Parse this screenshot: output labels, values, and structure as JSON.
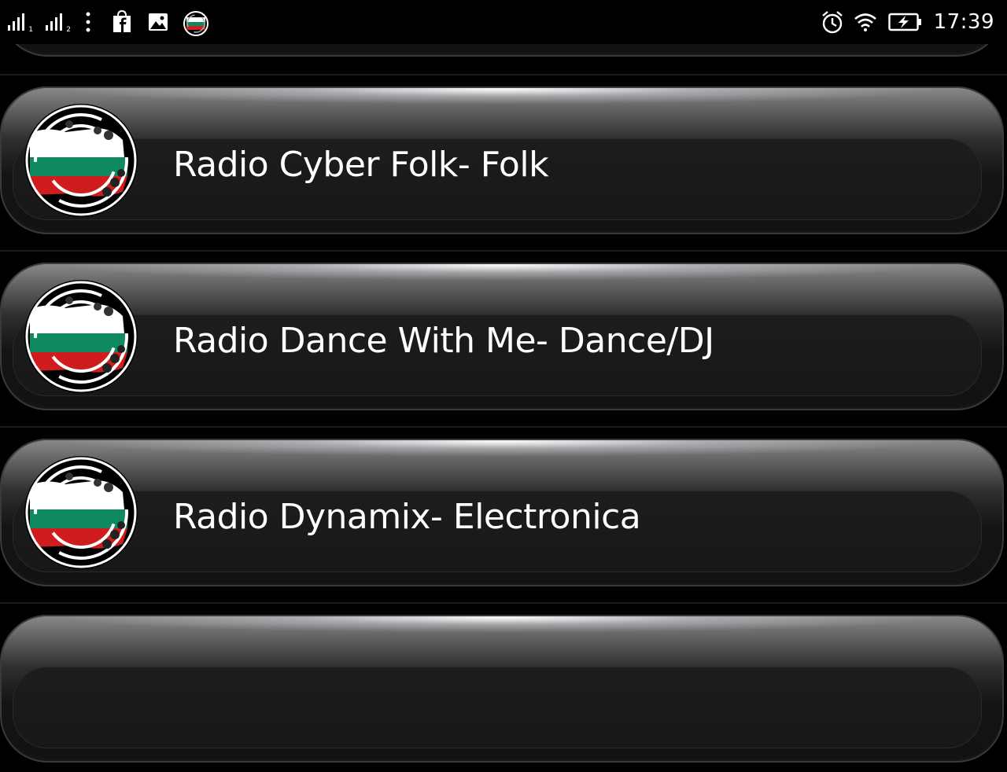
{
  "status_bar": {
    "sim1_label": "1",
    "sim2_label": "2",
    "time": "17:39",
    "icons": [
      "signal-sim1-icon",
      "signal-sim2-icon",
      "more-notifications-icon",
      "facebook-bag-icon",
      "image-icon",
      "radio-app-icon",
      "alarm-icon",
      "wifi-icon",
      "battery-charging-icon"
    ]
  },
  "stations": [
    {
      "name": "Radio Cyber Folk- Folk"
    },
    {
      "name": "Radio Dance With Me- Dance/DJ"
    },
    {
      "name": "Radio Dynamix- Electronica"
    }
  ],
  "colors": {
    "flag_white": "#ffffff",
    "flag_green": "#0f8a5f",
    "flag_red": "#d01c1f"
  }
}
